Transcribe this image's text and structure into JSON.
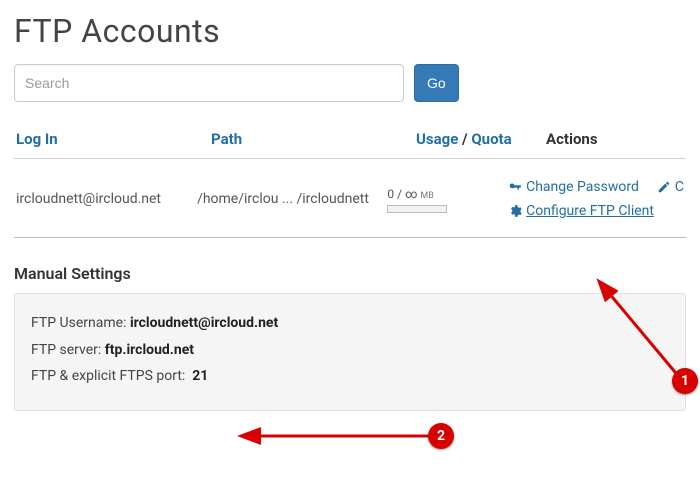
{
  "page": {
    "title": "FTP Accounts"
  },
  "search": {
    "placeholder": "Search",
    "go_label": "Go"
  },
  "table": {
    "headers": {
      "login": "Log In",
      "path": "Path",
      "usage": "Usage",
      "quota": "Quota",
      "actions": "Actions",
      "sep": "/"
    },
    "rows": [
      {
        "login": "ircloudnett@ircloud.net",
        "path": "/home/irclou ... /ircloudnett",
        "usage": "0",
        "sep": "/",
        "quota": "∞",
        "unit": "MB"
      }
    ],
    "actions": {
      "change_password": "Change Password",
      "configure": "Configure FTP Client",
      "truncated": "C"
    }
  },
  "manual": {
    "title": "Manual Settings",
    "username_label": "FTP Username:",
    "username_value": "ircloudnett@ircloud.net",
    "server_label": "FTP server:",
    "server_value": "ftp.ircloud.net",
    "port_label": "FTP & explicit FTPS port:",
    "port_value": "21"
  },
  "annotations": {
    "badge1": "1",
    "badge2": "2"
  }
}
